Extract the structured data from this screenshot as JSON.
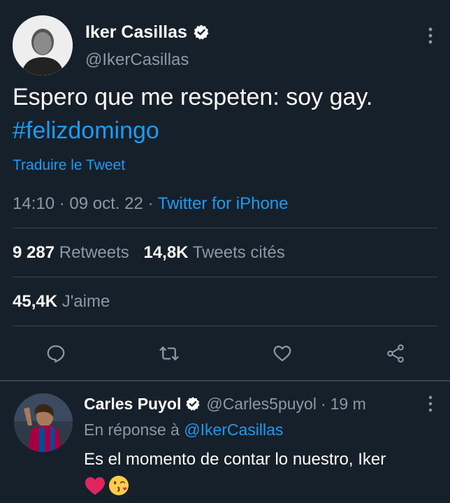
{
  "tweet": {
    "author_name": "Iker Casillas",
    "author_handle": "@IkerCasillas",
    "text": "Espero que me respeten: soy gay.",
    "hashtag": "#felizdomingo",
    "translate": "Traduire le Tweet",
    "time": "14:10",
    "sep1": "·",
    "date": "09 oct. 22",
    "sep2": "·",
    "source": "Twitter for iPhone",
    "retweets_count": "9 287",
    "retweets_label": "Retweets",
    "quotes_count": "14,8K",
    "quotes_label": "Tweets cités",
    "likes_count": "45,4K",
    "likes_label": "J'aime"
  },
  "reply": {
    "author_name": "Carles Puyol",
    "author_handle": "@Carles5puyol",
    "sep": "·",
    "age": "19 m",
    "in_reply_prefix": "En réponse à",
    "in_reply_handle": "@IkerCasillas",
    "text": "Es el momento de contar lo nuestro, Iker",
    "emojis": "❤️😘"
  },
  "colors": {
    "background": "#15202b",
    "accent": "#1d9bf0",
    "muted": "#8b98a5",
    "divider": "#38444d",
    "heart": "#f91880"
  },
  "icons": [
    "more-icon",
    "verified-icon",
    "reply-icon",
    "retweet-icon",
    "like-icon",
    "share-icon"
  ]
}
